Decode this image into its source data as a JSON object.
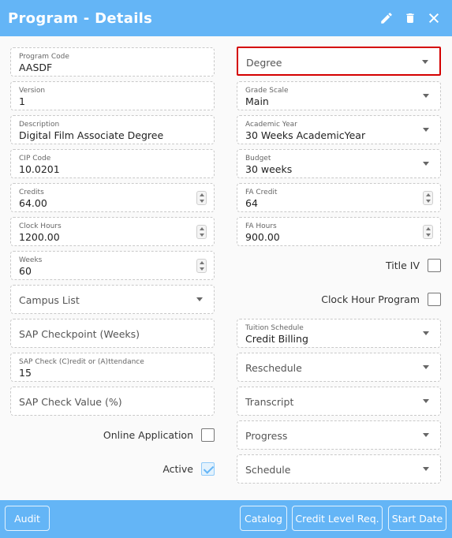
{
  "window": {
    "title": "Program - Details"
  },
  "header_actions": [
    "pencil-icon",
    "trash-icon",
    "close-icon"
  ],
  "left_fields": {
    "program_code": {
      "label": "Program Code",
      "value": "AASDF"
    },
    "version": {
      "label": "Version",
      "value": "1"
    },
    "description": {
      "label": "Description",
      "value": "Digital Film Associate Degree"
    },
    "cip_code": {
      "label": "CIP Code",
      "value": "10.0201"
    },
    "credits": {
      "label": "Credits",
      "value": "64.00"
    },
    "clock_hours": {
      "label": "Clock Hours",
      "value": "1200.00"
    },
    "weeks": {
      "label": "Weeks",
      "value": "60"
    },
    "campus_list": {
      "placeholder": "Campus List"
    },
    "sap_checkpoint": {
      "placeholder": "SAP Checkpoint (Weeks)"
    },
    "sap_check_type": {
      "label": "SAP Check (C)redit or (A)ttendance",
      "value": "15"
    },
    "sap_check_value": {
      "placeholder": "SAP Check Value (%)"
    }
  },
  "right_fields": {
    "degree": {
      "placeholder": "Degree"
    },
    "grade_scale": {
      "label": "Grade Scale",
      "value": "Main"
    },
    "academic_year": {
      "label": "Academic Year",
      "value": "30 Weeks AcademicYear"
    },
    "budget": {
      "label": "Budget",
      "value": "30 weeks"
    },
    "fa_credit": {
      "label": "FA Credit",
      "value": "64"
    },
    "fa_hours": {
      "label": "FA Hours",
      "value": "900.00"
    },
    "tuition_schedule": {
      "label": "Tuition Schedule",
      "value": "Credit Billing"
    },
    "reschedule": {
      "placeholder": "Reschedule"
    },
    "transcript": {
      "placeholder": "Transcript"
    },
    "progress": {
      "placeholder": "Progress"
    },
    "schedule": {
      "placeholder": "Schedule"
    }
  },
  "checkboxes": {
    "title_iv": {
      "label": "Title IV",
      "checked": false
    },
    "clock_hour_program": {
      "label": "Clock Hour Program",
      "checked": false
    },
    "online_application": {
      "label": "Online Application",
      "checked": false
    },
    "active": {
      "label": "Active",
      "checked": true
    }
  },
  "footer": {
    "audit": "Audit",
    "catalog": "Catalog",
    "credit_level": "Credit Level Req.",
    "start_date": "Start Date"
  },
  "colors": {
    "accent": "#64b5f6",
    "highlight": "#d40000"
  }
}
